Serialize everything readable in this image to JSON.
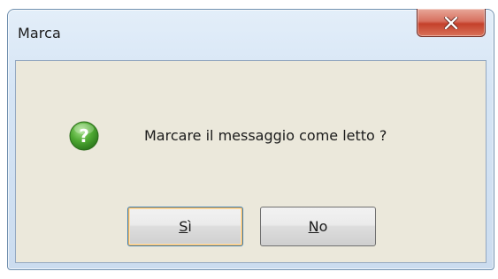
{
  "window": {
    "title": "Marca"
  },
  "dialog": {
    "icon": "question-icon",
    "message": "Marcare il messaggio come letto ?",
    "buttons": {
      "yes": {
        "mnemonic": "S",
        "rest": "ì"
      },
      "no": {
        "mnemonic": "N",
        "rest": "o"
      }
    }
  },
  "colors": {
    "close_button": "#c4402b",
    "icon_green": "#3f9b2a",
    "client_background": "#ebe8db",
    "default_button_glow": "#f5b45a"
  }
}
